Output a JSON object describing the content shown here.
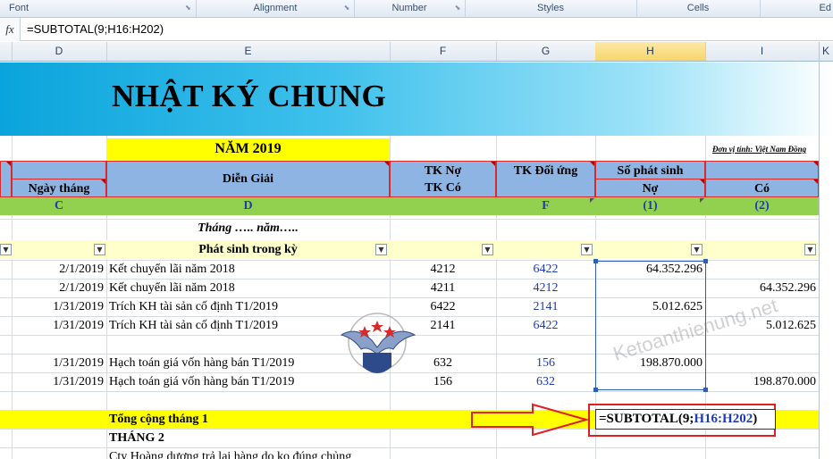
{
  "ribbon": {
    "groups": [
      {
        "label": "Font"
      },
      {
        "label": "Alignment"
      },
      {
        "label": "Number"
      },
      {
        "label": "Styles"
      },
      {
        "label": "Cells"
      },
      {
        "label": "Ed"
      }
    ]
  },
  "formula_bar": {
    "fx_label": "fx",
    "formula": "=SUBTOTAL(9;H16:H202)"
  },
  "columns": [
    "D",
    "E",
    "F",
    "G",
    "H",
    "I",
    "K"
  ],
  "sheet": {
    "title": "NHẬT KÝ CHUNG",
    "year_label": "NĂM 2019",
    "unit_label": "Đơn vị tính: Việt Nam Đồng",
    "headers": {
      "ngay_thang": "Ngày tháng",
      "dien_giai": "Diễn Giải",
      "tk_no": "TK Nợ",
      "tk_co": "TK Có",
      "tk_doi_ung": "TK Đối ứng",
      "so_phat_sinh": "Số phát sinh",
      "no": "Nợ",
      "co": "Có"
    },
    "codes": {
      "c": "C",
      "d": "D",
      "f": "F",
      "h": "(1)",
      "i": "(2)"
    },
    "month_placeholder": "Tháng ….. năm…..",
    "phat_sinh_label": "Phát sinh trong kỳ",
    "rows": [
      {
        "date": "2/1/2019",
        "desc": "Kết chuyển lãi năm 2018",
        "tk": "4212",
        "doi_ung": "6422",
        "no": "64.352.296",
        "co": ""
      },
      {
        "date": "2/1/2019",
        "desc": "Kết chuyển lãi năm 2018",
        "tk": "4211",
        "doi_ung": "4212",
        "no": "",
        "co": "64.352.296"
      },
      {
        "date": "1/31/2019",
        "desc": "Trích KH tài sản cố định T1/2019",
        "tk": "6422",
        "doi_ung": "2141",
        "no": "5.012.625",
        "co": ""
      },
      {
        "date": "1/31/2019",
        "desc": "Trích KH tài sản cố định T1/2019",
        "tk": "2141",
        "doi_ung": "6422",
        "no": "",
        "co": "5.012.625"
      },
      {
        "date": "",
        "desc": "",
        "tk": "",
        "doi_ung": "",
        "no": "",
        "co": ""
      },
      {
        "date": "1/31/2019",
        "desc": "Hạch toán giá vốn hàng bán T1/2019",
        "tk": "632",
        "doi_ung": "156",
        "no": "198.870.000",
        "co": ""
      },
      {
        "date": "1/31/2019",
        "desc": "Hạch toán giá vốn hàng bán T1/2019",
        "tk": "156",
        "doi_ung": "632",
        "no": "",
        "co": "198.870.000"
      }
    ],
    "total_label": "Tổng cộng tháng 1",
    "total_formula_prefix": "=SUBTOTAL(9;",
    "total_formula_ref": "H16:H202",
    "total_formula_suffix": ")",
    "month2_label": "THÁNG 2",
    "next_row_desc": "Cty Hoàng dương trả lại hàng do ko đúng chủng"
  },
  "watermark": "Ketoanthienung.net",
  "colors": {
    "banner": "#0aa4dc",
    "header_fill": "#8db4e2",
    "code_row": "#92d050",
    "total_row": "#ffff00",
    "arrow": "#e02020"
  }
}
